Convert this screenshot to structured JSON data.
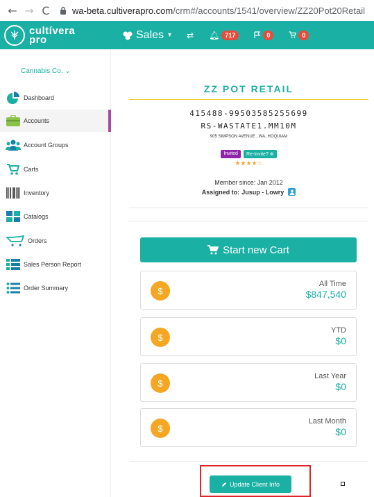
{
  "browser": {
    "back_icon": "←",
    "forward_icon": "→",
    "reload_icon": "C",
    "url_host": "wa-beta.cultiverapro.com",
    "url_path": "/crm#/accounts/1541/overview/ZZ20Pot20Retail"
  },
  "header": {
    "logo_line1": "cultívera",
    "logo_line2": "pro",
    "sales_label": "Sales",
    "notifications_count": "717",
    "flag_count": "0",
    "cart_count": "0",
    "brand_color": "#1ab0a4"
  },
  "sidebar": {
    "company": "Cannabis Co.",
    "items": [
      {
        "label": "Dashboard",
        "icon": "dashboard-pie-icon"
      },
      {
        "label": "Accounts",
        "icon": "briefcase-icon"
      },
      {
        "label": "Account Groups",
        "icon": "users-icon"
      },
      {
        "label": "Carts",
        "icon": "cart-icon"
      },
      {
        "label": "Inventory",
        "icon": "barcode-icon"
      },
      {
        "label": "Catalogs",
        "icon": "grid-icon"
      },
      {
        "label": "Orders",
        "icon": "cart-outline-icon"
      },
      {
        "label": "Sales Person Report",
        "icon": "list-icon"
      },
      {
        "label": "Order Summary",
        "icon": "list-icon"
      }
    ]
  },
  "account": {
    "title": "ZZ POT RETAIL",
    "number": "415488-99503585255699",
    "license": "RS-WASTATE1.MM10M",
    "address": "905 SIMPSON AVENUE , WA, HOQUIAM",
    "invited_label": "Invited",
    "reinvite_label": "Re-Invite?",
    "rating_stars": "★★★★☆",
    "rating": 4,
    "member_since": "Member since: Jan 2012",
    "assigned_label": "Assigned to:",
    "assigned_to": "Jusup - Lowry"
  },
  "actions": {
    "start_cart": "Start new Cart",
    "update_client": "Update Client Info"
  },
  "stats": [
    {
      "label": "All Time",
      "value": "$847,540",
      "icon": "$"
    },
    {
      "label": "YTD",
      "value": "$0",
      "icon": "$"
    },
    {
      "label": "Last Year",
      "value": "$0",
      "icon": "$"
    },
    {
      "label": "Last Month",
      "value": "$0",
      "icon": "$"
    }
  ]
}
